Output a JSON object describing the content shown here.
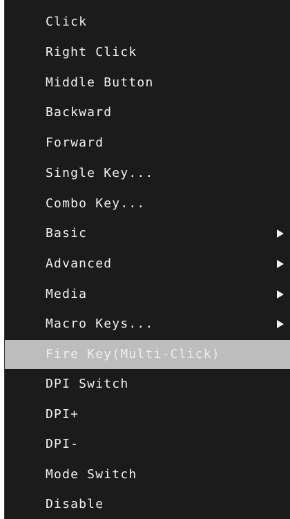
{
  "context_menu": {
    "items": [
      {
        "label": "Click",
        "submenu": false,
        "highlighted": false
      },
      {
        "label": "Right Click",
        "submenu": false,
        "highlighted": false
      },
      {
        "label": "Middle Button",
        "submenu": false,
        "highlighted": false
      },
      {
        "label": "Backward",
        "submenu": false,
        "highlighted": false
      },
      {
        "label": "Forward",
        "submenu": false,
        "highlighted": false
      },
      {
        "label": "Single Key...",
        "submenu": false,
        "highlighted": false
      },
      {
        "label": "Combo Key...",
        "submenu": false,
        "highlighted": false
      },
      {
        "label": "Basic",
        "submenu": true,
        "highlighted": false
      },
      {
        "label": "Advanced",
        "submenu": true,
        "highlighted": false
      },
      {
        "label": "Media",
        "submenu": true,
        "highlighted": false
      },
      {
        "label": "Macro Keys...",
        "submenu": true,
        "highlighted": false
      },
      {
        "label": "Fire Key(Multi-Click)",
        "submenu": false,
        "highlighted": true
      },
      {
        "label": "DPI Switch",
        "submenu": false,
        "highlighted": false
      },
      {
        "label": "DPI+",
        "submenu": false,
        "highlighted": false
      },
      {
        "label": "DPI-",
        "submenu": false,
        "highlighted": false
      },
      {
        "label": "Mode Switch",
        "submenu": false,
        "highlighted": false
      },
      {
        "label": "Disable",
        "submenu": false,
        "highlighted": false
      }
    ],
    "colors": {
      "background": "#1b1b1b",
      "text": "#f1f1f1",
      "highlight": "#bdbdbd"
    }
  }
}
